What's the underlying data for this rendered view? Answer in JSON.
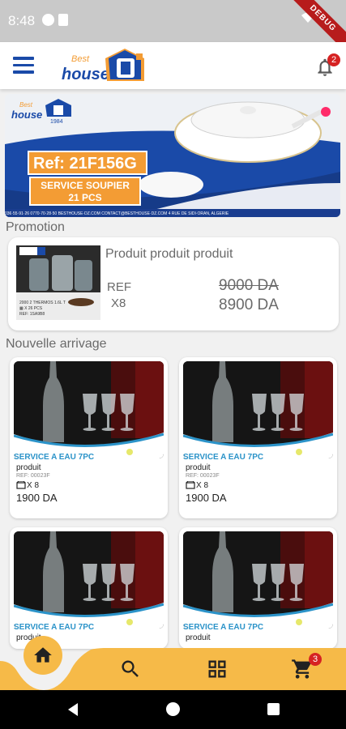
{
  "status_bar": {
    "time": "8:48",
    "debug_label": "DEBUG"
  },
  "app_bar": {
    "logo_best": "Best",
    "logo_house": "house",
    "notification_count": "2"
  },
  "banner": {
    "logo_best": "Best",
    "logo_house": "house",
    "logo_year": "1984",
    "ref": "Ref: 21F156G",
    "title_line1": "SERVICE SOUPIER",
    "title_line2": "21 PCS",
    "footer": "036·55·91·26   0770·70·28·50   BESTHOUSE·DZ.COM   CONTACT@BESTHOUSE·DZ.COM   4 RUE DE SIDI·ORAN, ALGERIE"
  },
  "promotion": {
    "section_title": "Promotion",
    "image_lines": [
      "2000 2 THERMOS 1.6L T",
      "▦ X 26 PCS",
      "REF: 1SA9B8"
    ],
    "name": "Produit produit produit",
    "ref_label": "REF",
    "qty": "X8",
    "old_price": "9000 DA",
    "new_price": "8900 DA"
  },
  "new_arrivals": {
    "section_title": "Nouvelle arrivage",
    "products": [
      {
        "name": "SERVICE A EAU 7PC",
        "label": "produit",
        "ref": "REF: 00023F",
        "qty": "X 8",
        "price": "1900 DA"
      },
      {
        "name": "SERVICE A EAU 7PC",
        "label": "produit",
        "ref": "REF: 00023F",
        "qty": "X 8",
        "price": "1900 DA"
      },
      {
        "name": "SERVICE A EAU 7PC",
        "label": "produit",
        "ref": "",
        "qty": "",
        "price": ""
      },
      {
        "name": "SERVICE A EAU 7PC",
        "label": "produit",
        "ref": "",
        "qty": "",
        "price": ""
      }
    ]
  },
  "bottom_nav": {
    "items": [
      "home-icon",
      "search-icon",
      "grid-icon",
      "cart-icon"
    ],
    "cart_count": "3",
    "accent": "#f6ba48"
  },
  "colors": {
    "brand_blue": "#1a4aa8",
    "orange": "#f39c34",
    "badge_red": "#d62222"
  }
}
